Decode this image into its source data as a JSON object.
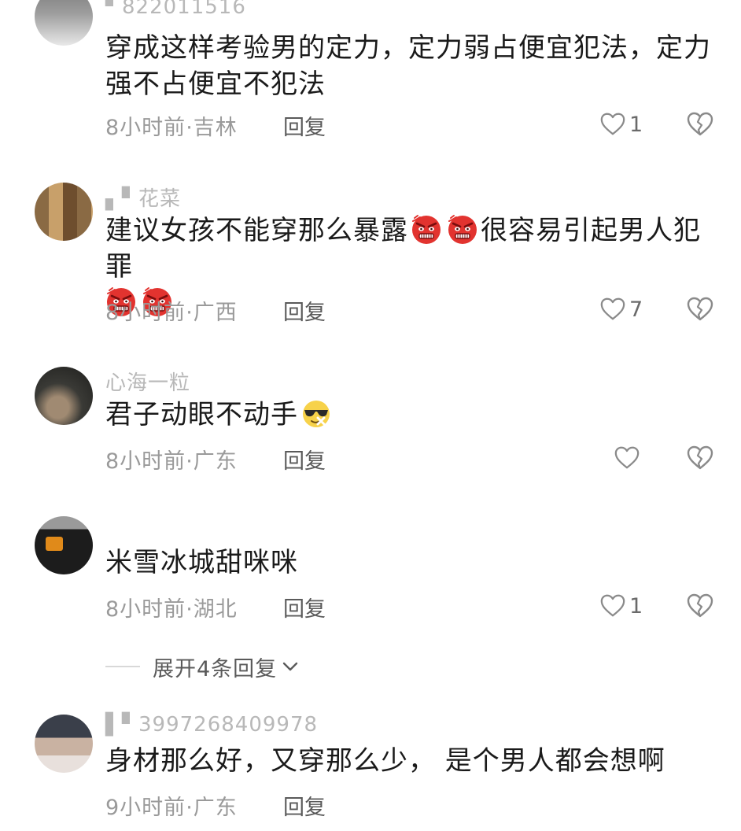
{
  "reply_label": "回复",
  "expand_replies": "展开4条回复",
  "comments": [
    {
      "username": "▘822011516",
      "text": "穿成这样考验男的定力，定力弱占便宜犯法，定力强不占便宜不犯法",
      "time": "8小时前",
      "location": "吉林",
      "likes": "1"
    },
    {
      "username": "▖▘花菜",
      "text_before": "建议女孩不能穿那么暴露",
      "text_after": "很容易引起男人犯罪",
      "time": "8小时前",
      "location": "广西",
      "likes": "7"
    },
    {
      "username": "心海一粒",
      "text": "君子动眼不动手",
      "time": "8小时前",
      "location": "广东",
      "likes": ""
    },
    {
      "username": "",
      "text": "米雪冰城甜咪咪",
      "time": "8小时前",
      "location": "湖北",
      "likes": "1"
    },
    {
      "username": "▌▘3997268409978",
      "text": "身材那么好，又穿那么少， 是个男人都会想啊",
      "time": "9小时前",
      "location": "广东",
      "likes": ""
    }
  ],
  "icons": {
    "like": "heart-outline-icon",
    "dislike": "broken-heart-icon",
    "angry": "angry-face-emoji",
    "cool": "sunglasses-face-emoji"
  },
  "colors": {
    "text": "#1a1a1a",
    "meta": "#9a9a9a",
    "username": "#b8b8b8",
    "angry_emoji": "#e2332f"
  }
}
